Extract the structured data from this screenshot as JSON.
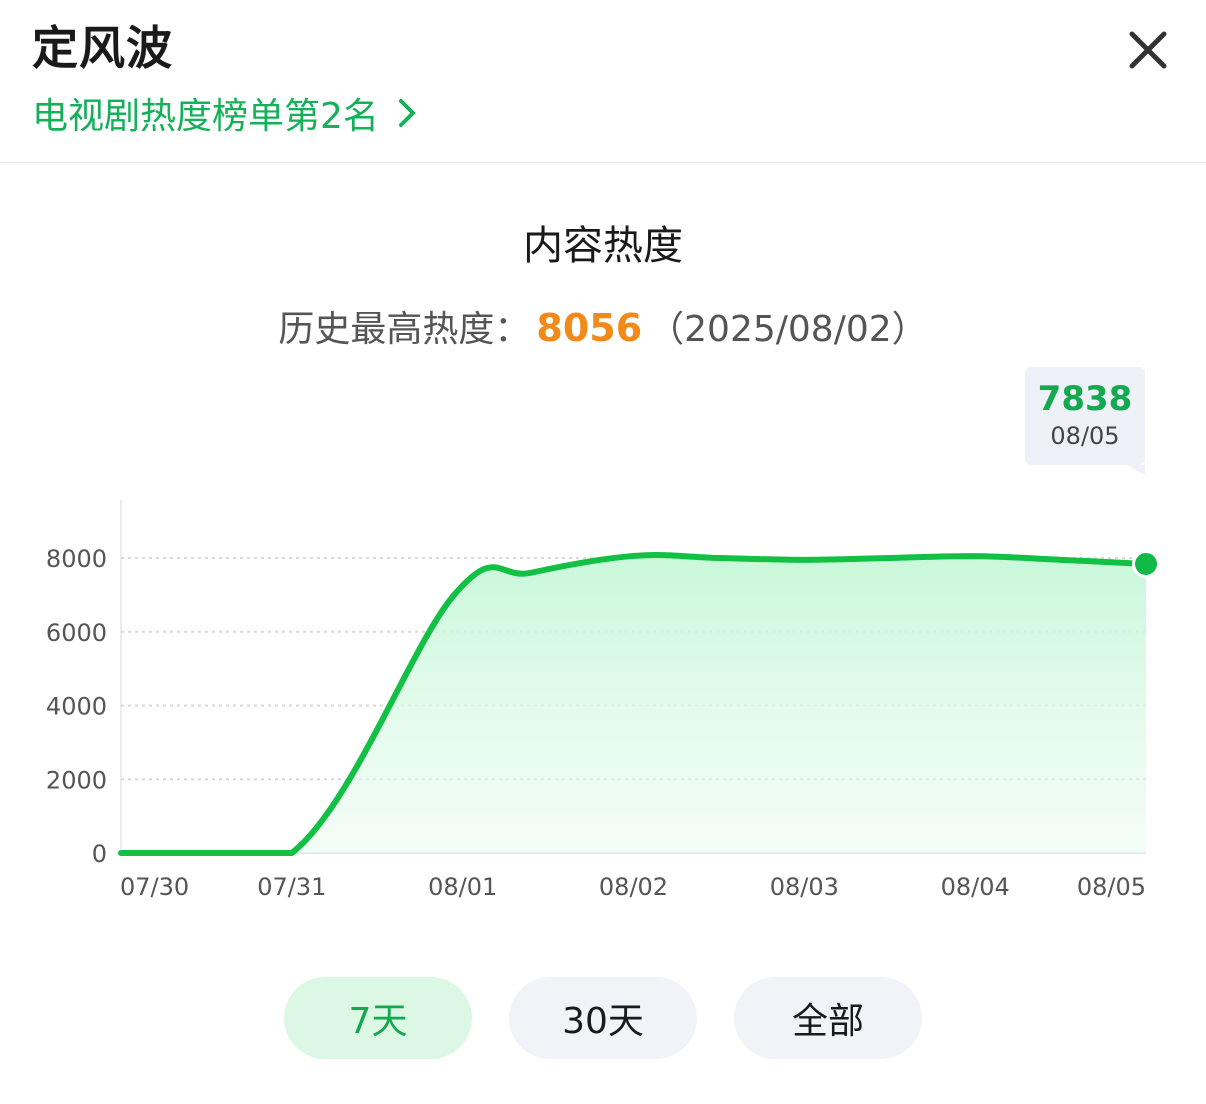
{
  "header": {
    "title": "定风波",
    "rank_text": "电视剧热度榜单第2名"
  },
  "icons": {
    "close": "close-icon",
    "rank_arrow": "chevron-right-icon"
  },
  "colors": {
    "accent_green": "#14b05a",
    "line_green": "#12c044",
    "peak_orange": "#f28a1a",
    "active_button_bg": "#dcf8e5",
    "inactive_button_bg": "#f1f3f8"
  },
  "chart_header": {
    "title": "内容热度",
    "peak_label": "历史最高热度：",
    "peak_value": "8056",
    "peak_date": "（2025/08/02）"
  },
  "tooltip": {
    "value": "7838",
    "date": "08/05"
  },
  "chart_data": {
    "type": "area",
    "title": "内容热度",
    "xlabel": "",
    "ylabel": "",
    "categories": [
      "07/30",
      "07/31",
      "08/01",
      "08/02",
      "08/03",
      "08/04",
      "08/05"
    ],
    "x_positions": [
      0,
      1,
      2,
      3,
      4,
      5,
      6
    ],
    "series": [
      {
        "x": [
          0,
          1,
          1.95,
          2.4,
          3,
          3.5,
          4,
          4.5,
          5,
          5.5,
          6
        ],
        "y": [
          0,
          0,
          7000,
          7600,
          8056,
          8000,
          7950,
          8000,
          8050,
          7950,
          7838
        ]
      }
    ],
    "yticks": [
      0,
      2000,
      4000,
      6000,
      8000
    ],
    "ylim": [
      0,
      8000
    ],
    "grid": true,
    "highlight_point": {
      "x": "08/05",
      "y": 7838
    }
  },
  "range_buttons": [
    {
      "label": "7天",
      "active": true
    },
    {
      "label": "30天",
      "active": false
    },
    {
      "label": "全部",
      "active": false
    }
  ]
}
